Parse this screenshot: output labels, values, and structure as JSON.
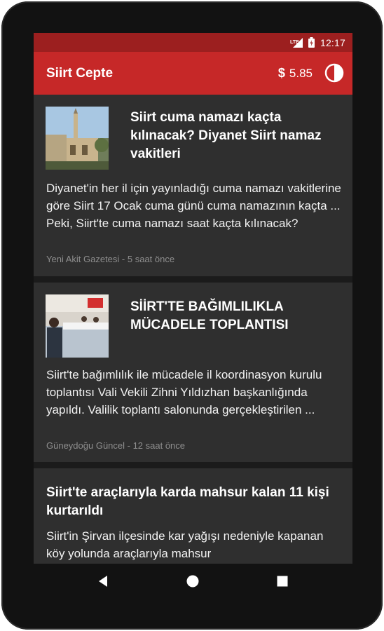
{
  "status_bar": {
    "network": "LTE",
    "time": "12:17"
  },
  "app_bar": {
    "title": "Siirt Cepte",
    "currency_symbol": "$",
    "price": "5.85"
  },
  "articles": [
    {
      "headline": "Siirt cuma namazı kaçta kılınacak? Diyanet Siirt namaz vakitleri",
      "summary": "Diyanet'in her il için yayınladığı cuma namazı vakitlerine göre Siirt 17 Ocak cuma günü cuma namazının kaçta ... Peki, Siirt'te cuma namazı saat kaçta kılınacak?",
      "meta": "Yeni Akit Gazetesi - 5 saat önce",
      "thumbnail": "mosque-photo"
    },
    {
      "headline": "SİİRT'TE BAĞIMLILIKLA MÜCADELE TOPLANTISI",
      "summary": "Siirt'te bağımlılık ile mücadele il koordinasyon kurulu toplantısı Vali Vekili Zihni Yıldızhan başkanlığında yapıldı. Valilik toplantı salonunda gerçekleştirilen ...",
      "meta": "Güneydoğu Güncel - 12 saat önce",
      "thumbnail": "meeting-photo"
    },
    {
      "headline": "Siirt'te araçlarıyla karda mahsur kalan 11 kişi kurtarıldı",
      "summary": "Siirt'in Şirvan ilçesinde kar yağışı nedeniyle kapanan köy yolunda araçlarıyla mahsur"
    }
  ],
  "nav_bar": {
    "back": "back-icon",
    "home": "home-icon",
    "recents": "recents-icon"
  },
  "colors": {
    "status_bar": "#9c1f1f",
    "app_bar": "#c62828",
    "card": "#2f2f2f",
    "background": "#1b1b1b"
  }
}
